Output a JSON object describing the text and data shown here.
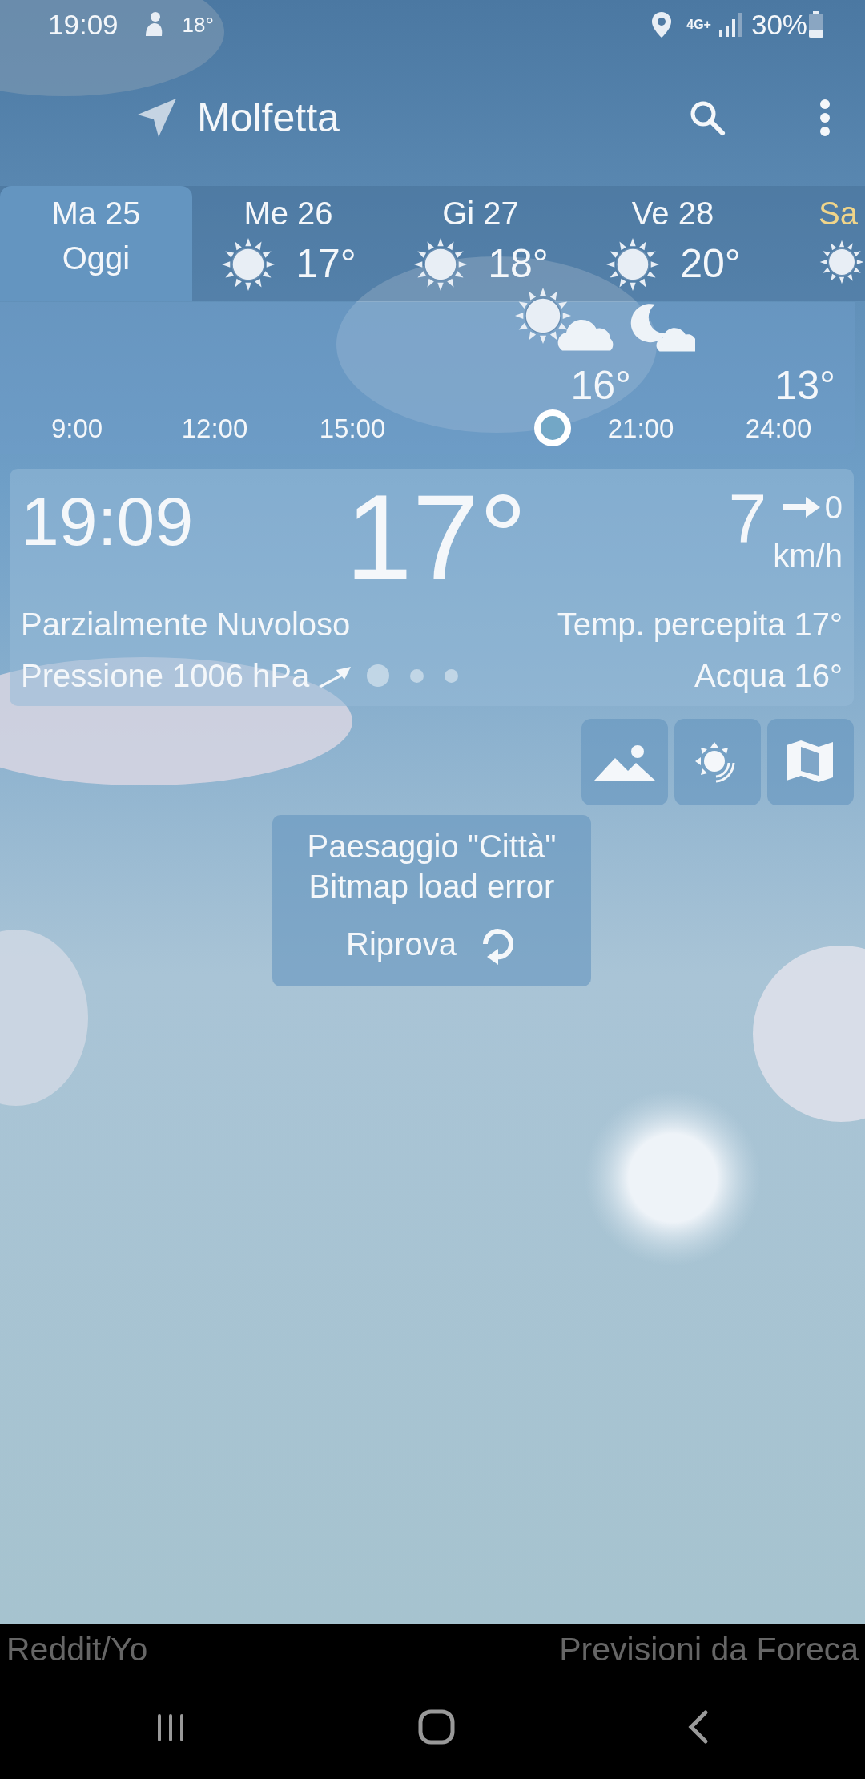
{
  "status_bar": {
    "time": "19:09",
    "temperature": "18°",
    "network": "4G+",
    "battery": "30%"
  },
  "header": {
    "city": "Molfetta"
  },
  "days": [
    {
      "label": "Ma 25",
      "sub": "Oggi",
      "selected": true,
      "weekend": false
    },
    {
      "label": "Me 26",
      "temp": "17°",
      "selected": false,
      "weekend": false
    },
    {
      "label": "Gi 27",
      "temp": "18°",
      "selected": false,
      "weekend": false
    },
    {
      "label": "Ve 28",
      "temp": "20°",
      "selected": false,
      "weekend": false
    },
    {
      "label": "Sa",
      "selected": false,
      "weekend": true
    }
  ],
  "timeline": {
    "forecasts": [
      {
        "kind": "sun-cloud",
        "temp": "16°"
      },
      {
        "kind": "moon-cloud",
        "temp": "13°"
      }
    ],
    "slots": [
      {
        "kind": "hour",
        "label": "9:00"
      },
      {
        "kind": "hour",
        "label": "12:00"
      },
      {
        "kind": "hour",
        "label": "15:00"
      },
      {
        "kind": "now"
      },
      {
        "kind": "hour",
        "label": "21:00"
      },
      {
        "kind": "hour",
        "label": "24:00"
      }
    ]
  },
  "current": {
    "time": "19:09",
    "temperature": "17°",
    "wind_speed": "7",
    "wind_gust": "0",
    "wind_unit": "km/h",
    "condition": "Parzialmente Nuvoloso",
    "feels_like": "Temp. percepita 17°",
    "pressure": "Pressione 1006 hPa",
    "water": "Acqua 16°",
    "pages": [
      {
        "selected": true
      },
      {
        "selected": false
      },
      {
        "selected": false
      }
    ]
  },
  "error": {
    "lines": [
      "Paesaggio \"Città\"",
      "Bitmap load error"
    ],
    "retry": "Riprova"
  },
  "footer": {
    "left": "Reddit/Yo",
    "right": "Previsioni da Foreca"
  }
}
